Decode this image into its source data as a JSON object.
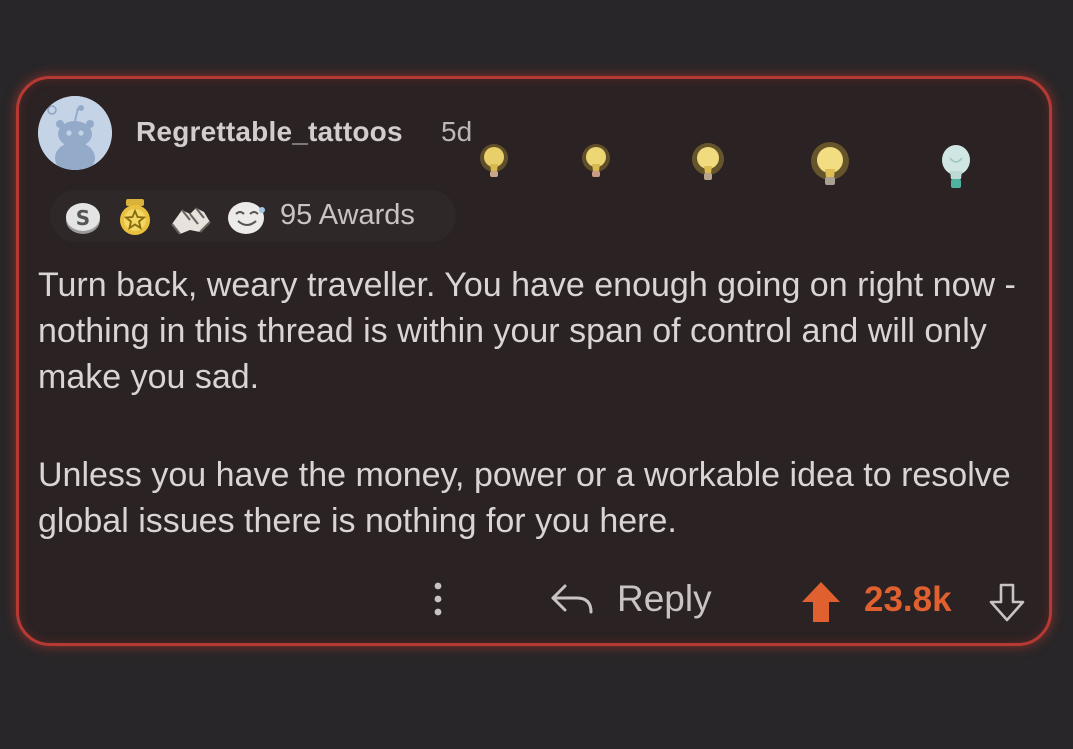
{
  "comment": {
    "author": "Regrettable_tattoos",
    "age": "5d",
    "awards_label": "95 Awards",
    "body": [
      "Turn back, weary traveller.  You have enough going on right now - nothing in this thread is within your span of control and will only make you sad.",
      "Unless you have the money, power or a workable idea to resolve global issues there is nothing for you here."
    ]
  },
  "actions": {
    "reply_label": "Reply",
    "score": "23.8k"
  },
  "icons": {
    "avatar": "snoo-avatar-icon",
    "awards": [
      "silver-coin-award-icon",
      "helpful-award-icon",
      "wholesome-hands-award-icon",
      "laughing-face-award-icon"
    ],
    "bulbs": [
      "lightbulb-icon",
      "lightbulb-icon",
      "lightbulb-icon",
      "lightbulb-icon",
      "lightbulb-icon"
    ],
    "more": "more-options-icon",
    "reply": "reply-arrow-icon",
    "upvote": "upvote-arrow-icon",
    "downvote": "downvote-arrow-icon"
  },
  "colors": {
    "card_border": "#b63a33",
    "upvote": "#e0602f",
    "background": "#282628"
  }
}
